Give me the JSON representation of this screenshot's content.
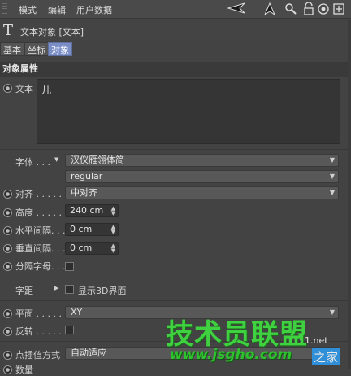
{
  "menu": {
    "items": [
      "模式",
      "编辑",
      "用户数据"
    ]
  },
  "toolbar_icons": [
    "back-arrow-icon",
    "cursor-arrow-icon",
    "search-icon",
    "lock-icon",
    "target-icon",
    "new-panel-icon"
  ],
  "object": {
    "icon": "T",
    "title": "文本对象 [文本]"
  },
  "tabs": [
    "基本",
    "坐标",
    "对象"
  ],
  "active_tab": "对象",
  "section_title": "对象属性",
  "text_param": {
    "label": "文本",
    "value": "儿"
  },
  "font": {
    "label": "字体 . . .",
    "family": "汉仪雁翎体简",
    "style": "regular"
  },
  "align": {
    "label": "对齐 . . . . .",
    "value": "中对齐"
  },
  "height": {
    "label": "高度 . . . . .",
    "value": "240 cm"
  },
  "h_spacing": {
    "label": "水平间隔. . .",
    "value": "0 cm"
  },
  "v_spacing": {
    "label": "垂直间隔. . .",
    "value": "0 cm"
  },
  "sep_letters": {
    "label": "分隔字母. . ."
  },
  "kerning": {
    "label": "字距",
    "checkbox_label": "显示3D界面"
  },
  "plane": {
    "label": "平面 . . . . .",
    "value": "XY"
  },
  "reverse": {
    "label": "反转 . . . . ."
  },
  "interpolation": {
    "label": "点插值方式",
    "value": "自动适应"
  },
  "number": {
    "label": "数量"
  },
  "watermark": {
    "main": "技术员联盟",
    "url": "www.jsgho.com",
    "tail": "之家",
    "domain": "51.net"
  },
  "colors": {
    "panel_bg": "#434343",
    "active_tab": "#7b8ec8",
    "watermark_green": "#3fd13f"
  }
}
